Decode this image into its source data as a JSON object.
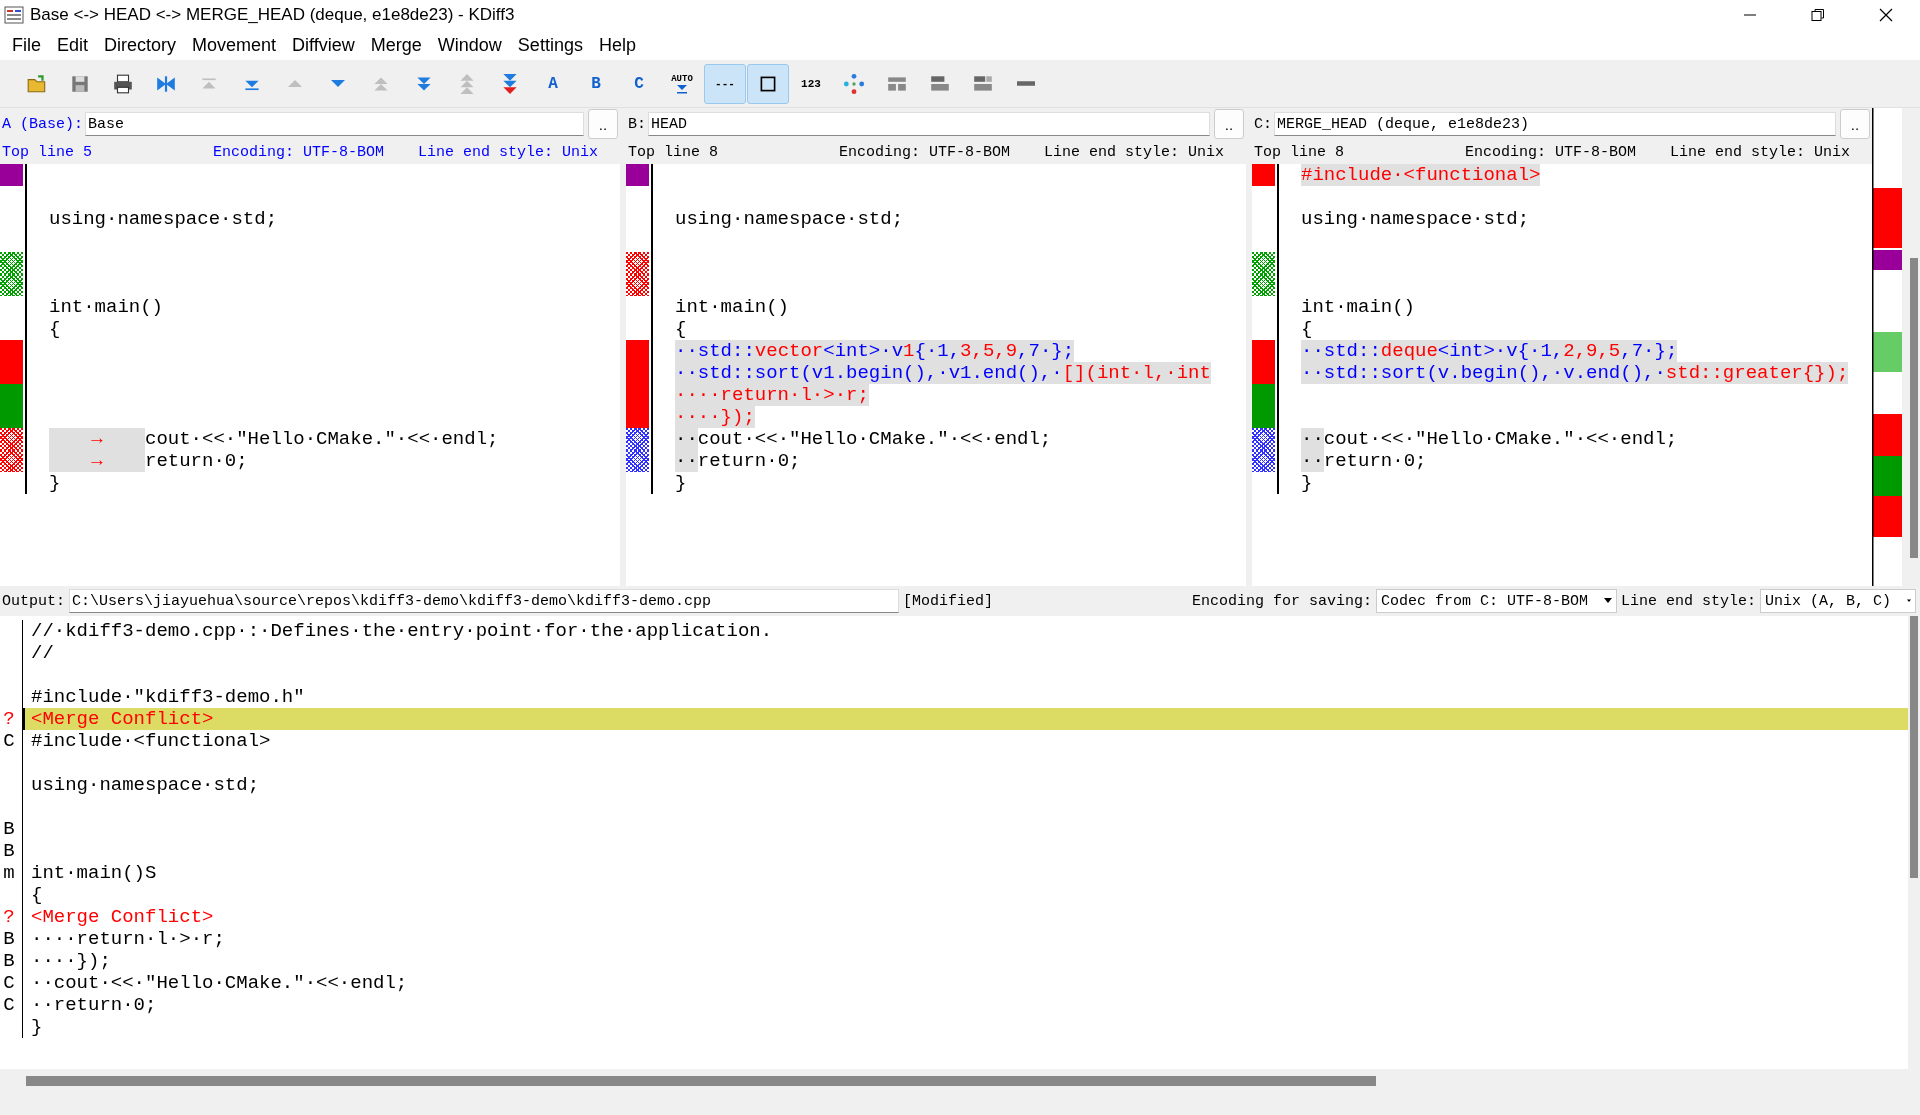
{
  "window": {
    "title": "Base <-> HEAD <-> MERGE_HEAD (deque, e1e8de23) - KDiff3"
  },
  "menu": [
    "File",
    "Edit",
    "Directory",
    "Movement",
    "Diffview",
    "Merge",
    "Window",
    "Settings",
    "Help"
  ],
  "toolbar": [
    {
      "kind": "open",
      "disabled": false,
      "selected": false
    },
    {
      "kind": "save",
      "disabled": false,
      "selected": false
    },
    {
      "kind": "print",
      "disabled": false,
      "selected": false
    },
    {
      "kind": "merge",
      "disabled": false,
      "selected": false
    },
    {
      "kind": "top",
      "disabled": true,
      "selected": false
    },
    {
      "kind": "bottom",
      "disabled": false,
      "selected": false
    },
    {
      "kind": "prev-delta",
      "disabled": true,
      "selected": false
    },
    {
      "kind": "next-delta",
      "disabled": false,
      "selected": false
    },
    {
      "kind": "prev-conflict",
      "disabled": true,
      "selected": false
    },
    {
      "kind": "next-conflict",
      "disabled": false,
      "selected": false
    },
    {
      "kind": "prev-unsolved",
      "disabled": true,
      "selected": false
    },
    {
      "kind": "next-unsolved",
      "disabled": false,
      "selected": false
    },
    {
      "kind": "choose",
      "label": "A",
      "disabled": false,
      "selected": false
    },
    {
      "kind": "choose",
      "label": "B",
      "disabled": false,
      "selected": false
    },
    {
      "kind": "choose",
      "label": "C",
      "disabled": false,
      "selected": false
    },
    {
      "kind": "auto",
      "label": "AUTO",
      "disabled": false,
      "selected": false
    },
    {
      "kind": "text",
      "label": "---",
      "disabled": false,
      "selected": true
    },
    {
      "kind": "square",
      "disabled": false,
      "selected": true
    },
    {
      "kind": "text",
      "label": "123",
      "disabled": false,
      "selected": false
    },
    {
      "kind": "diamond",
      "disabled": false,
      "selected": false
    },
    {
      "kind": "split-three",
      "disabled": false,
      "selected": false
    },
    {
      "kind": "split-two",
      "disabled": false,
      "selected": false
    },
    {
      "kind": "split-stack",
      "disabled": false,
      "selected": false
    },
    {
      "kind": "bar",
      "disabled": false,
      "selected": false
    }
  ],
  "panes": [
    {
      "label": "A (Base):",
      "file": "Base",
      "button": "..",
      "active": true,
      "top_line": "Top line 5",
      "encoding": "Encoding: UTF-8-BOM",
      "line_end": "Line end style: Unix",
      "lines": [
        {
          "kind": "solid",
          "color": "#990099"
        },
        {
          "kind": "blank"
        },
        {
          "segments": [
            {
              "text": "using·namespace·std;"
            }
          ]
        },
        {
          "kind": "blank"
        },
        {
          "kind": "hatched",
          "color": "#00a000"
        },
        {
          "kind": "hatched",
          "color": "#00a000"
        },
        {
          "segments": [
            {
              "text": "int·main()"
            }
          ]
        },
        {
          "segments": [
            {
              "text": "{"
            }
          ]
        },
        {
          "kind": "solid",
          "color": "#ff0000"
        },
        {
          "kind": "solid",
          "color": "#ff0000"
        },
        {
          "kind": "solid",
          "color": "#009900"
        },
        {
          "kind": "solid",
          "color": "#009900"
        },
        {
          "kind": "hatched",
          "color": "#ff0000",
          "segments": [
            {
              "text": "→",
              "tab": true,
              "highlight": true
            },
            {
              "text": "cout·<<·\"Hello·CMake.\"·<<·endl;"
            }
          ]
        },
        {
          "kind": "hatched",
          "color": "#ff0000",
          "segments": [
            {
              "text": "→",
              "tab": true,
              "highlight": true
            },
            {
              "text": "return·0;"
            }
          ]
        },
        {
          "segments": [
            {
              "text": "}"
            }
          ]
        }
      ]
    },
    {
      "label": "B:",
      "file": "HEAD",
      "button": "..",
      "active": false,
      "top_line": "Top line 8",
      "encoding": "Encoding: UTF-8-BOM",
      "line_end": "Line end style: Unix",
      "lines": [
        {
          "kind": "solid",
          "color": "#990099"
        },
        {
          "kind": "blank"
        },
        {
          "segments": [
            {
              "text": "using·namespace·std;"
            }
          ]
        },
        {
          "kind": "blank"
        },
        {
          "kind": "hatched",
          "color": "#ff0000"
        },
        {
          "kind": "hatched",
          "color": "#ff0000"
        },
        {
          "segments": [
            {
              "text": "int·main()"
            }
          ]
        },
        {
          "segments": [
            {
              "text": "{"
            }
          ]
        },
        {
          "kind": "solid",
          "color": "#ff0000",
          "segments": [
            {
              "text": "··std::",
              "color": "#0000ff",
              "highlight": true
            },
            {
              "text": "vector",
              "color": "#ff0000",
              "highlight": true
            },
            {
              "text": "<int>·v",
              "color": "#0000ff",
              "highlight": true
            },
            {
              "text": "1",
              "color": "#ff0000",
              "highlight": true
            },
            {
              "text": "{·1,",
              "color": "#0000ff",
              "highlight": true
            },
            {
              "text": "3,5,9",
              "color": "#ff0000",
              "highlight": true
            },
            {
              "text": ",7·};",
              "color": "#0000ff",
              "highlight": true
            }
          ]
        },
        {
          "kind": "solid",
          "color": "#ff0000",
          "segments": [
            {
              "text": "··std::sort(v1.begin(),·v1.end(),·",
              "color": "#0000ff",
              "highlight": true
            },
            {
              "text": "[](int·l,·int",
              "color": "#ff0000",
              "highlight": true
            }
          ]
        },
        {
          "kind": "solid",
          "color": "#ff0000",
          "segments": [
            {
              "text": "····return·l·>·r;",
              "color": "#ff0000",
              "highlight": true
            }
          ]
        },
        {
          "kind": "solid",
          "color": "#ff0000",
          "segments": [
            {
              "text": "····});",
              "color": "#ff0000",
              "highlight": true
            }
          ]
        },
        {
          "kind": "hatched",
          "color": "#3030ff",
          "segments": [
            {
              "text": "··",
              "highlight": true
            },
            {
              "text": "cout·<<·\"Hello·CMake.\"·<<·endl;"
            }
          ]
        },
        {
          "kind": "hatched",
          "color": "#3030ff",
          "segments": [
            {
              "text": "··",
              "highlight": true
            },
            {
              "text": "return·0;"
            }
          ]
        },
        {
          "segments": [
            {
              "text": "}"
            }
          ]
        }
      ]
    },
    {
      "label": "C:",
      "file": "MERGE_HEAD (deque, e1e8de23)",
      "button": "..",
      "active": false,
      "top_line": "Top line 8",
      "encoding": "Encoding: UTF-8-BOM",
      "line_end": "Line end style: Unix",
      "lines": [
        {
          "kind": "solid",
          "color": "#ff0000",
          "segments": [
            {
              "text": "#include·<functional>",
              "color": "#ff0000",
              "highlight": true
            }
          ]
        },
        {
          "kind": "blank"
        },
        {
          "segments": [
            {
              "text": "using·namespace·std;"
            }
          ]
        },
        {
          "kind": "blank"
        },
        {
          "kind": "hatched",
          "color": "#00a000"
        },
        {
          "kind": "hatched",
          "color": "#00a000"
        },
        {
          "segments": [
            {
              "text": "int·main()"
            }
          ]
        },
        {
          "segments": [
            {
              "text": "{"
            }
          ]
        },
        {
          "kind": "solid",
          "color": "#ff0000",
          "segments": [
            {
              "text": "··std::",
              "color": "#0000ff",
              "highlight": true
            },
            {
              "text": "deque",
              "color": "#ff0000",
              "highlight": true
            },
            {
              "text": "<int>·v{·1,",
              "color": "#0000ff",
              "highlight": true
            },
            {
              "text": "2,9,5",
              "color": "#ff0000",
              "highlight": true
            },
            {
              "text": ",7·};",
              "color": "#0000ff",
              "highlight": true
            }
          ]
        },
        {
          "kind": "solid",
          "color": "#ff0000",
          "segments": [
            {
              "text": "··std::sort(v.begin(),·v.end(),·",
              "color": "#0000ff",
              "highlight": true
            },
            {
              "text": "std::greater{});",
              "color": "#ff0000",
              "highlight": true
            }
          ]
        },
        {
          "kind": "solid",
          "color": "#009900"
        },
        {
          "kind": "solid",
          "color": "#009900"
        },
        {
          "kind": "hatched",
          "color": "#3030ff",
          "segments": [
            {
              "text": "··",
              "highlight": true
            },
            {
              "text": "cout·<<·\"Hello·CMake.\"·<<·endl;"
            }
          ]
        },
        {
          "kind": "hatched",
          "color": "#3030ff",
          "segments": [
            {
              "text": "··",
              "highlight": true
            },
            {
              "text": "return·0;"
            }
          ]
        },
        {
          "segments": [
            {
              "text": "}"
            }
          ]
        }
      ]
    }
  ],
  "output": {
    "label": "Output:",
    "path": "C:\\Users\\jiayuehua\\source\\repos\\kdiff3-demo\\kdiff3-demo\\kdiff3-demo.cpp",
    "status": "[Modified]",
    "encoding_label": "Encoding for saving:",
    "encoding": "Codec from C: UTF-8-BOM",
    "line_end_label": "Line end style:",
    "line_end": "Unix (A, B, C)",
    "lines": [
      {
        "kind": "code",
        "text": "//·kdiff3-demo.cpp·:·Defines·the·entry·point·for·the·application."
      },
      {
        "kind": "code",
        "text": "//"
      },
      {
        "kind": "code"
      },
      {
        "kind": "code",
        "text": "#include·\"kdiff3-demo.h\""
      },
      {
        "kind": "conflict",
        "source": "?",
        "text": "<Merge Conflict>",
        "selected": true
      },
      {
        "kind": "code",
        "source": "C",
        "text": "#include·<functional>",
        "selected": false
      },
      {
        "kind": "code"
      },
      {
        "kind": "code",
        "text": "using·namespace·std;"
      },
      {
        "kind": "code"
      },
      {
        "kind": "code",
        "source": "B",
        "selected": false
      },
      {
        "kind": "code",
        "source": "B",
        "selected": false
      },
      {
        "kind": "code",
        "source": "m",
        "text": "int·main()S",
        "selected": false
      },
      {
        "kind": "code",
        "text": "{"
      },
      {
        "kind": "conflict",
        "source": "?",
        "text": "<Merge Conflict>",
        "selected": false
      },
      {
        "kind": "code",
        "source": "B",
        "text": "····return·l·>·r;",
        "selected": false
      },
      {
        "kind": "code",
        "source": "B",
        "text": "····});",
        "selected": false
      },
      {
        "kind": "code",
        "source": "C",
        "text": "··cout·<<·\"Hello·CMake.\"·<<·endl;",
        "selected": false
      },
      {
        "kind": "code",
        "source": "C",
        "text": "··return·0;",
        "selected": false
      },
      {
        "kind": "code",
        "text": "}"
      }
    ]
  }
}
